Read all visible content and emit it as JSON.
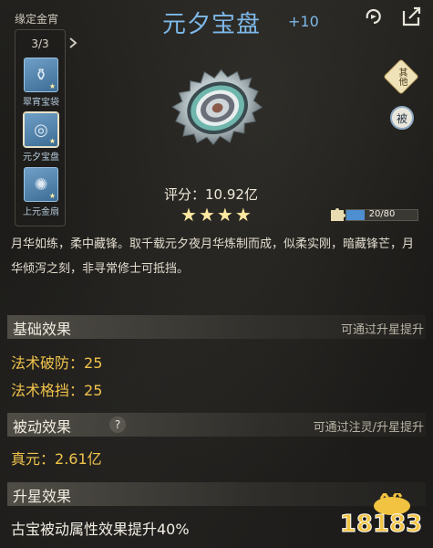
{
  "set": {
    "title": "缘定金宵",
    "count": "3/3",
    "items": [
      {
        "label": "翠宵宝袋",
        "icon": "pouch-icon"
      },
      {
        "label": "元夕宝盘",
        "icon": "plate-icon",
        "selected": true
      },
      {
        "label": "上元金扇",
        "icon": "fan-icon"
      }
    ]
  },
  "item": {
    "name": "元夕宝盘",
    "refine": "+10",
    "score_label": "评分：",
    "score_value": "10.92亿",
    "stars": 4,
    "progress_text": "20/80",
    "progress": 0.25,
    "description": "月华如练，柔中藏锋。取千载元夕夜月华炼制而成，似柔实刚，暗藏锋芒，月华倾泻之刻，非寻常修士可抵挡。"
  },
  "badges": {
    "other": "其他",
    "passive": "被"
  },
  "sections": {
    "basic": {
      "title": "基础效果",
      "note": "可通过升星提升",
      "rows": [
        {
          "label": "法术破防：",
          "value": "25"
        },
        {
          "label": "法术格挡：",
          "value": "25"
        }
      ]
    },
    "passive": {
      "title": "被动效果",
      "help": "?",
      "note": "可通过注灵/升星提升",
      "rows": [
        {
          "label": "真元：",
          "value": "2.61亿"
        }
      ]
    },
    "star": {
      "title": "升星效果",
      "text": "古宝被动属性效果提升40%"
    }
  },
  "watermark": "18183",
  "colors": {
    "accent_blue": "#7db8e8",
    "gold": "#f0c34b",
    "star": "#ffe8a0",
    "progress": "#4d8fd0"
  }
}
